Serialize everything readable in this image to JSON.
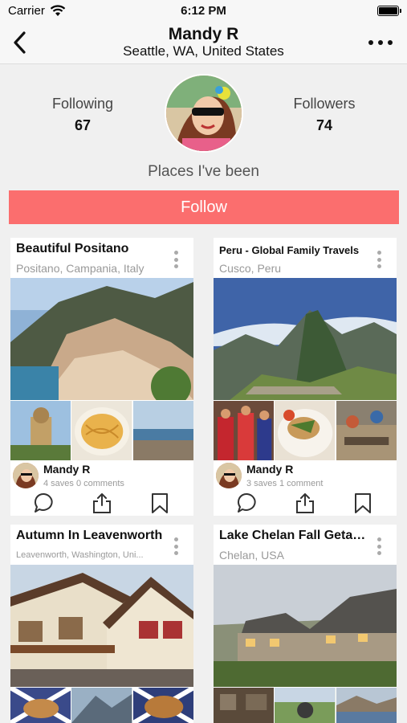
{
  "status_bar": {
    "carrier": "Carrier",
    "time": "6:12 PM"
  },
  "nav": {
    "title": "Mandy R",
    "subtitle": "Seattle, WA, United States"
  },
  "profile": {
    "following_label": "Following",
    "following_count": "67",
    "followers_label": "Followers",
    "followers_count": "74",
    "places_heading": "Places I've been",
    "follow_button": "Follow"
  },
  "cards": [
    {
      "title": "Beautiful Positano",
      "location": "Positano, Campania, Italy",
      "owner": "Mandy R",
      "meta": "4 saves  0 comments"
    },
    {
      "title": "Peru - Global Family Travels",
      "location": "Cusco, Peru",
      "owner": "Mandy R",
      "meta": "3 saves  1 comment"
    },
    {
      "title": "Autumn In Leavenworth",
      "location": "Leavenworth, Washington, Uni..."
    },
    {
      "title": "Lake Chelan Fall Getaway",
      "location": "Chelan,  USA"
    }
  ],
  "icons": {
    "back": "chevron-left-icon",
    "more": "ellipsis-icon",
    "comment": "comment-bubble-icon",
    "share": "share-icon",
    "save": "bookmark-icon"
  },
  "colors": {
    "accent": "#fb6e6e",
    "background": "#f0f0f0"
  }
}
